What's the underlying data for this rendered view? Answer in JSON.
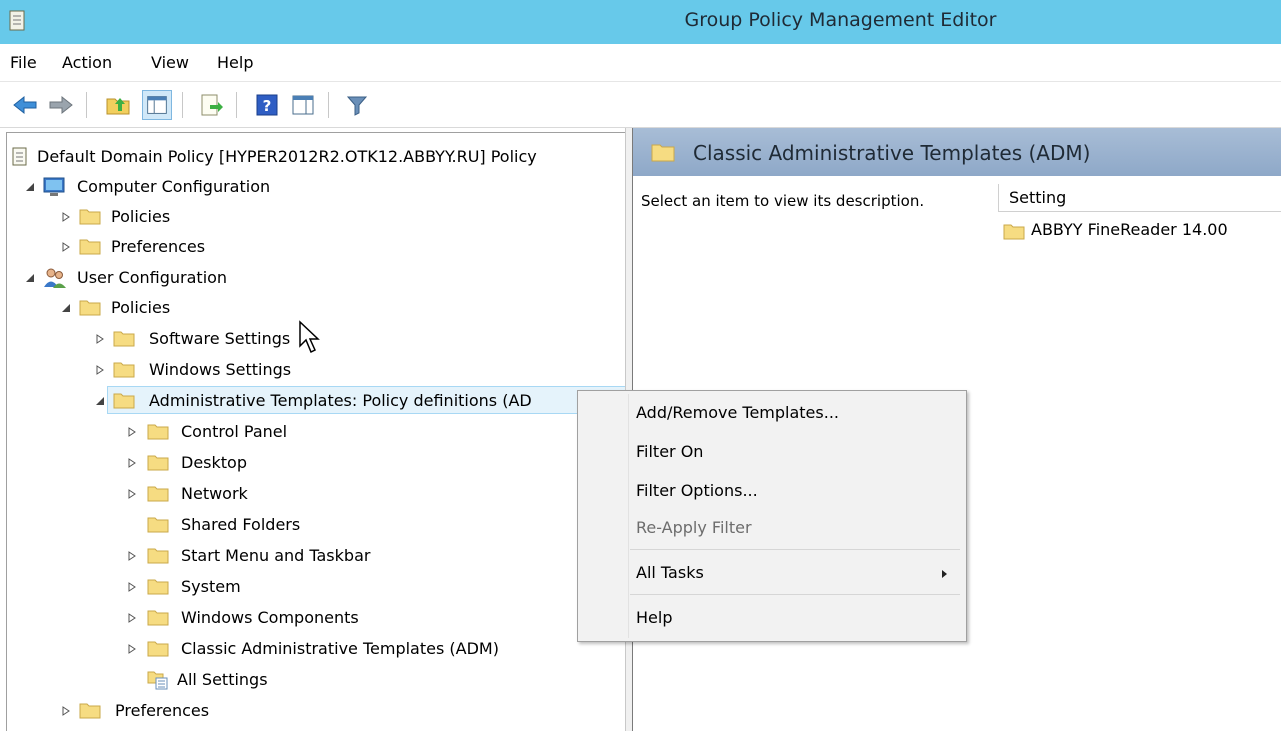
{
  "window": {
    "title": "Group Policy Management Editor"
  },
  "menubar": {
    "items": [
      "File",
      "Action",
      "View",
      "Help"
    ]
  },
  "toolbar": {
    "buttons": [
      "back-icon",
      "forward-icon",
      "up-folder-icon",
      "show-hide-tree-icon",
      "export-list-icon",
      "help-icon",
      "action-pane-icon",
      "filter-icon"
    ]
  },
  "tree": {
    "root": "Default Domain Policy [HYPER2012R2.OTK12.ABBYY.RU] Policy",
    "computer_config": "Computer Configuration",
    "cc_policies": "Policies",
    "cc_preferences": "Preferences",
    "user_config": "User Configuration",
    "uc_policies": "Policies",
    "software_settings": "Software Settings",
    "windows_settings": "Windows Settings",
    "admin_templates": "Administrative Templates: Policy definitions (AD",
    "control_panel": "Control Panel",
    "desktop": "Desktop",
    "network": "Network",
    "shared_folders": "Shared Folders",
    "start_menu": "Start Menu and Taskbar",
    "system": "System",
    "windows_components": "Windows Components",
    "classic_adm": "Classic Administrative Templates (ADM)",
    "all_settings": "All Settings",
    "uc_preferences": "Preferences"
  },
  "right_pane": {
    "header": "Classic Administrative Templates (ADM)",
    "description": "Select an item to view its description.",
    "column": "Setting",
    "items": [
      "ABBYY FineReader 14.00"
    ]
  },
  "context_menu": {
    "add_remove": "Add/Remove Templates...",
    "filter_on": "Filter On",
    "filter_options": "Filter Options...",
    "reapply": "Re-Apply Filter",
    "all_tasks": "All Tasks",
    "help": "Help"
  },
  "colors": {
    "titlebar": "#67c9ea",
    "header": "#9db3cf",
    "folder": "#f6dc82"
  }
}
